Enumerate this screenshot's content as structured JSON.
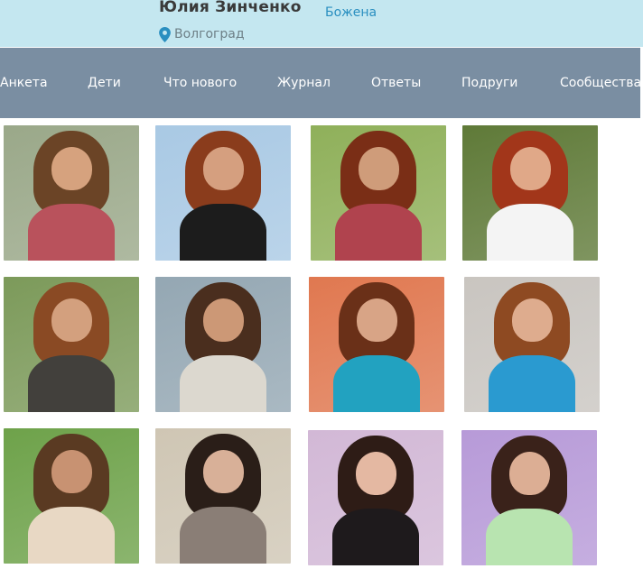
{
  "header": {
    "name": "Юлия Зинченко",
    "city": "Волгоград",
    "link": "Божена",
    "pin_icon": "location-pin-icon",
    "colors": {
      "background": "#c4e7f0",
      "link": "#2a8fc0",
      "pin": "#2a8fc0"
    }
  },
  "nav": {
    "background": "#7a8ea2",
    "items": [
      {
        "label": "Анкета"
      },
      {
        "label": "Дети"
      },
      {
        "label": "Что нового"
      },
      {
        "label": "Журнал"
      },
      {
        "label": "Ответы"
      },
      {
        "label": "Подруги"
      },
      {
        "label": "Сообщества"
      }
    ]
  },
  "gallery": {
    "photos": [
      {
        "bg": "#9aa889",
        "hair": "#6b4426",
        "skin": "#d6a27e",
        "body": "#b9525c"
      },
      {
        "bg": "#a9c9e4",
        "hair": "#8a3c1c",
        "skin": "#d59f7f",
        "body": "#1c1c1c"
      },
      {
        "bg": "#8fb05a",
        "hair": "#7a2e16",
        "skin": "#cf9c7a",
        "body": "#b0434e"
      },
      {
        "bg": "#5f7a38",
        "hair": "#a2361a",
        "skin": "#e0a888",
        "body": "#f4f4f4"
      },
      {
        "bg": "#7c9a5a",
        "hair": "#8a4a24",
        "skin": "#d3a07e",
        "body": "#42403c"
      },
      {
        "bg": "#94a7b3",
        "hair": "#4a2e1e",
        "skin": "#cc9876",
        "body": "#dcd8cf"
      },
      {
        "bg": "#e07850",
        "hair": "#6a3018",
        "skin": "#d8a486",
        "body": "#22a2c0"
      },
      {
        "bg": "#c9c5c0",
        "hair": "#8e4a22",
        "skin": "#deac8e",
        "body": "#2a9ad0"
      },
      {
        "bg": "#6ea24a",
        "hair": "#5a3a22",
        "skin": "#c89272",
        "body": "#e8d8c4"
      },
      {
        "bg": "#cfc6b4",
        "hair": "#2a1e18",
        "skin": "#d8b098",
        "body": "#8a7e76"
      },
      {
        "bg": "#d2b8d6",
        "hair": "#2e1c16",
        "skin": "#e4b8a2",
        "body": "#1e1a1c"
      },
      {
        "bg": "#b79ad8",
        "hair": "#3a221a",
        "skin": "#dcae94",
        "body": "#b8e4b0"
      }
    ]
  }
}
